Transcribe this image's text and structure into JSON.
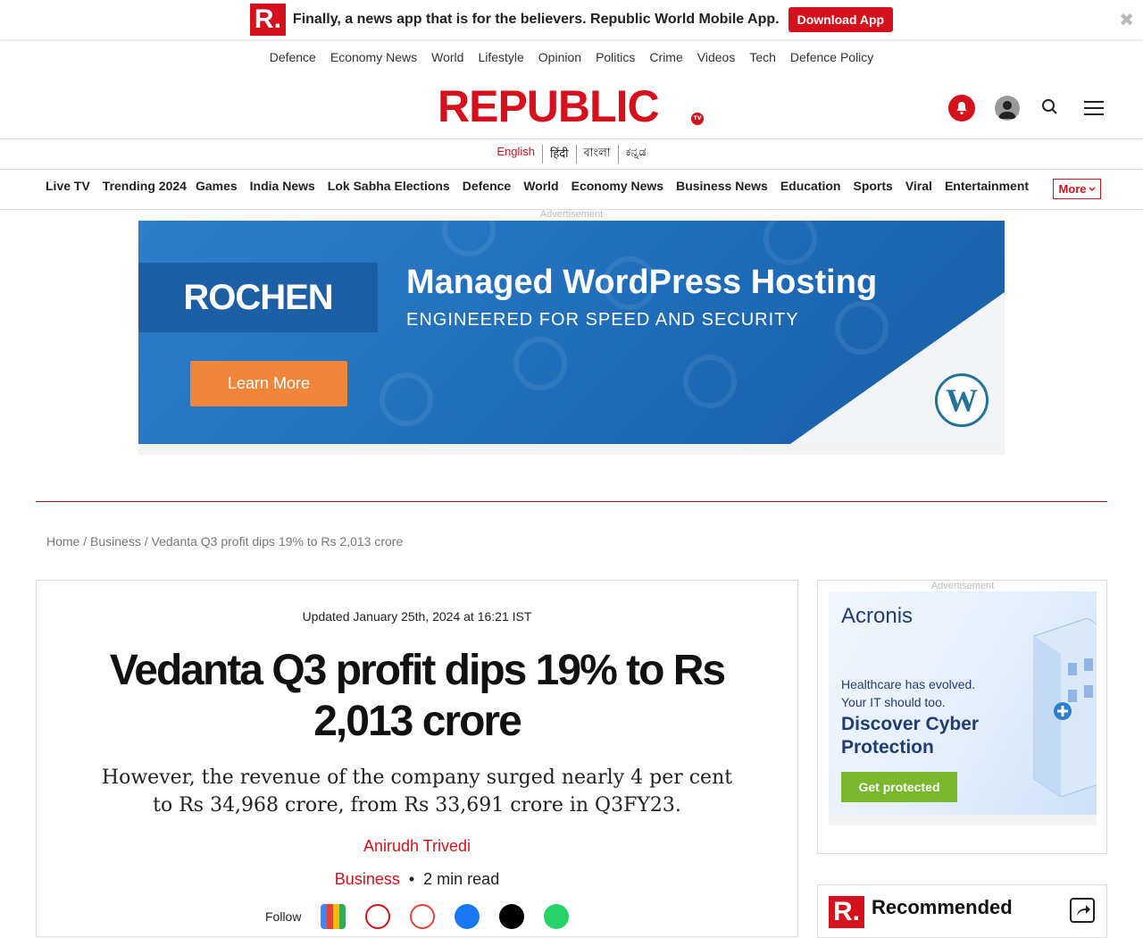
{
  "promo": {
    "logo": "R.",
    "text": "Finally, a news app that is for the believers. Republic World Mobile App.",
    "button": "Download App",
    "close": "✖"
  },
  "top_links": [
    "Defence",
    "Economy News",
    "World",
    "Lifestyle",
    "Opinion",
    "Politics",
    "Crime",
    "Videos",
    "Tech",
    "Defence Policy"
  ],
  "logo": {
    "text": "REPUBLIC",
    "badge": "TV"
  },
  "header_icons": [
    "bell-icon",
    "user-icon",
    "search-icon",
    "menu-icon"
  ],
  "languages": [
    {
      "label": "English",
      "active": true
    },
    {
      "label": "हिंदी",
      "active": false
    },
    {
      "label": "বাংলা",
      "active": false
    },
    {
      "label": "ಕನ್ನಡ",
      "active": false
    }
  ],
  "categories": [
    "Live TV",
    "Trending 2024",
    "Games",
    "India News",
    "Lok Sabha Elections",
    "Defence",
    "World",
    "Economy News",
    "Business News",
    "Education",
    "Sports",
    "Viral",
    "Entertainment"
  ],
  "more_label": "More",
  "ad_top": {
    "label": "Advertisement",
    "brand": "ROCHEN",
    "headline": "Managed WordPress Hosting",
    "subhead": "ENGINEERED FOR SPEED AND SECURITY",
    "cta": "Learn More",
    "wp_logo": "W"
  },
  "breadcrumb": {
    "home": "Home",
    "sep1": " / ",
    "section": "Business",
    "sep2": " / ",
    "current": "Vedanta Q3 profit dips 19% to Rs 2,013 crore"
  },
  "article": {
    "updated": "Updated January 25th, 2024 at 16:21 IST",
    "headline": "Vedanta Q3 profit dips 19% to Rs 2,013 crore",
    "deck": "However, the revenue of the company surged nearly 4 per cent to Rs 34,968 crore, from Rs 33,691 crore in Q3FY23.",
    "author": "Anirudh Trivedi",
    "category": "Business",
    "bullet": "•",
    "read_time": "2 min read",
    "follow_label": "Follow",
    "share_icons": [
      "google-news-icon",
      "republic-icon",
      "google-icon",
      "facebook-icon",
      "x-icon",
      "whatsapp-icon"
    ]
  },
  "side_ad": {
    "label": "Advertisement",
    "brand": "Acronis",
    "line1": "Healthcare has evolved.",
    "line2": "Your IT should too.",
    "headline1": "Discover Cyber",
    "headline2": "Protection",
    "cta": "Get protected"
  },
  "recommended": {
    "logo": "R.",
    "title": "Recommended"
  },
  "colors": {
    "brand_red": "#d6111e",
    "ad_blue": "#1f6cb8",
    "cta_orange": "#f0863a",
    "acronis_green": "#78b82a",
    "acronis_navy": "#1f3e75"
  }
}
